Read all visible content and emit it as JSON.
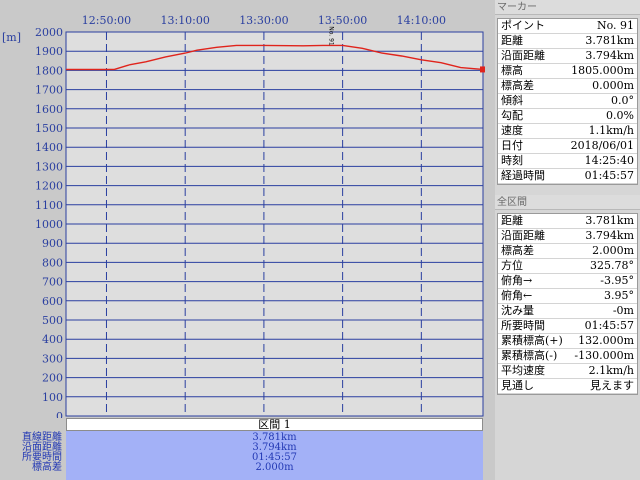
{
  "chart_data": {
    "type": "line",
    "ylabel": "[m]",
    "ylim": [
      0,
      2000
    ],
    "yticks": [
      0,
      100,
      200,
      300,
      400,
      500,
      600,
      700,
      800,
      900,
      1000,
      1100,
      1200,
      1300,
      1400,
      1500,
      1600,
      1700,
      1800,
      1900,
      2000
    ],
    "xlim": [
      "12:39:43",
      "14:25:40"
    ],
    "xticks": [
      "12:50:00",
      "13:10:00",
      "13:30:00",
      "13:50:00",
      "14:10:00"
    ],
    "marker_label": "No. 91",
    "series": [
      {
        "color": "#e0241c",
        "x": [
          "12:39:43",
          "12:52:00",
          "12:56:00",
          "13:00:00",
          "13:05:00",
          "13:10:00",
          "13:13:00",
          "13:18:00",
          "13:23:00",
          "13:30:00",
          "13:40:00",
          "13:45:00",
          "13:50:00",
          "13:55:00",
          "14:00:00",
          "14:05:00",
          "14:10:00",
          "14:15:00",
          "14:20:00",
          "14:25:40"
        ],
        "y": [
          1805,
          1805,
          1830,
          1845,
          1870,
          1890,
          1905,
          1920,
          1930,
          1930,
          1928,
          1930,
          1930,
          1915,
          1890,
          1875,
          1855,
          1840,
          1815,
          1805
        ]
      }
    ]
  },
  "section": {
    "header": "区間 1",
    "labels": [
      "直線距離",
      "沿面距離",
      "所要時間",
      "標高差"
    ],
    "values": [
      "3.781km",
      "3.794km",
      "01:45:57",
      "2.000m"
    ]
  },
  "marker_panel": {
    "title": "マーカー",
    "rows": [
      {
        "k": "ポイント",
        "v": "No. 91"
      },
      {
        "k": "距離",
        "v": "3.781km"
      },
      {
        "k": "沿面距離",
        "v": "3.794km"
      },
      {
        "k": "標高",
        "v": "1805.000m"
      },
      {
        "k": "標高差",
        "v": "0.000m"
      },
      {
        "k": "傾斜",
        "v": "0.0°"
      },
      {
        "k": "勾配",
        "v": "0.0%"
      },
      {
        "k": "速度",
        "v": "1.1km/h"
      },
      {
        "k": "日付",
        "v": "2018/06/01"
      },
      {
        "k": "時刻",
        "v": "14:25:40"
      },
      {
        "k": "経過時間",
        "v": "01:45:57"
      }
    ]
  },
  "total_panel": {
    "title": "全区間",
    "rows": [
      {
        "k": "距離",
        "v": "3.781km"
      },
      {
        "k": "沿面距離",
        "v": "3.794km"
      },
      {
        "k": "標高差",
        "v": "2.000m"
      },
      {
        "k": "方位",
        "v": "325.78°"
      },
      {
        "k": "俯角→",
        "v": "-3.95°"
      },
      {
        "k": "俯角←",
        "v": "3.95°"
      },
      {
        "k": "沈み量",
        "v": "-0m"
      },
      {
        "k": "所要時間",
        "v": "01:45:57"
      },
      {
        "k": "累積標高(+)",
        "v": "132.000m"
      },
      {
        "k": "累積標高(-)",
        "v": "-130.000m"
      },
      {
        "k": "平均速度",
        "v": "2.1km/h"
      },
      {
        "k": "見通し",
        "v": "見えます"
      }
    ]
  }
}
